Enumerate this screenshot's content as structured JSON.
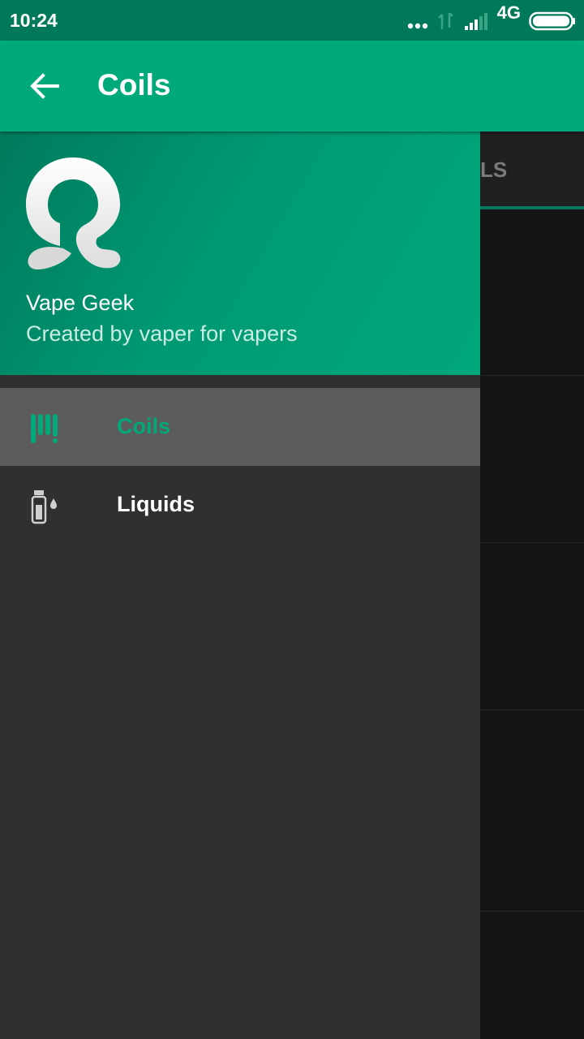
{
  "status_bar": {
    "time": "10:24",
    "network": "4G",
    "icons": [
      "more-dots-icon",
      "data-transfer-icon",
      "signal-icon",
      "battery-icon"
    ]
  },
  "app_bar": {
    "title": "Coils",
    "back_icon": "arrow-back-icon"
  },
  "background": {
    "tab_label_partial": "LS"
  },
  "drawer": {
    "header": {
      "logo_icon": "vape-geek-logo",
      "title": "Vape Geek",
      "subtitle": "Created by vaper for vapers"
    },
    "items": [
      {
        "label": "Coils",
        "icon": "coils-icon",
        "active": true
      },
      {
        "label": "Liquids",
        "icon": "liquid-bottle-icon",
        "active": false
      }
    ]
  },
  "colors": {
    "primary": "#00a97a",
    "primary_dark": "#00795a",
    "drawer_bg": "#303030",
    "active_item_bg": "#5c5c5c"
  }
}
